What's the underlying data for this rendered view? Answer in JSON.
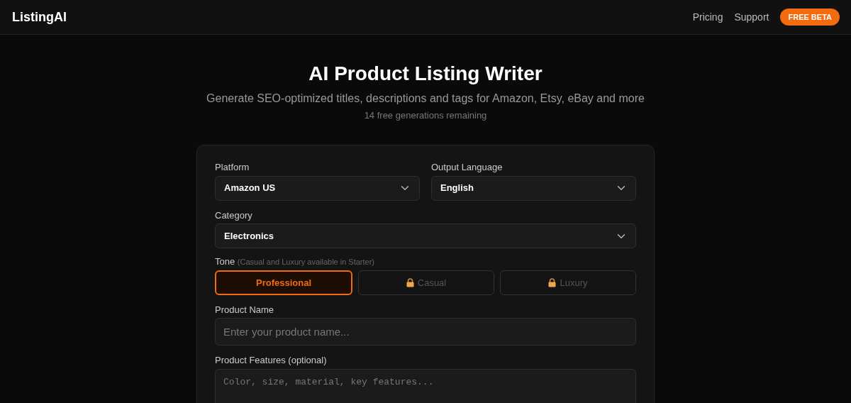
{
  "navbar": {
    "brand": "ListingAI",
    "links": [
      "Pricing",
      "Support"
    ],
    "badge": "FREE BETA"
  },
  "hero": {
    "title": "AI Product Listing Writer",
    "subtitle": "Generate SEO-optimized titles, descriptions and tags for Amazon, Etsy, eBay and more",
    "remaining": "14 free generations remaining"
  },
  "form": {
    "platform": {
      "label": "Platform",
      "value": "Amazon US"
    },
    "language": {
      "label": "Output Language",
      "value": "English"
    },
    "category": {
      "label": "Category",
      "value": "Electronics"
    },
    "tone": {
      "label": "Tone",
      "note": "(Casual and Luxury available in Starter)",
      "options": [
        {
          "label": "Professional",
          "selected": true,
          "locked": false
        },
        {
          "label": "Casual",
          "selected": false,
          "locked": true
        },
        {
          "label": "Luxury",
          "selected": false,
          "locked": true
        }
      ]
    },
    "product_name": {
      "label": "Product Name",
      "placeholder": "Enter your product name..."
    },
    "features": {
      "label": "Product Features (optional)",
      "placeholder": "Color, size, material, key features..."
    }
  }
}
